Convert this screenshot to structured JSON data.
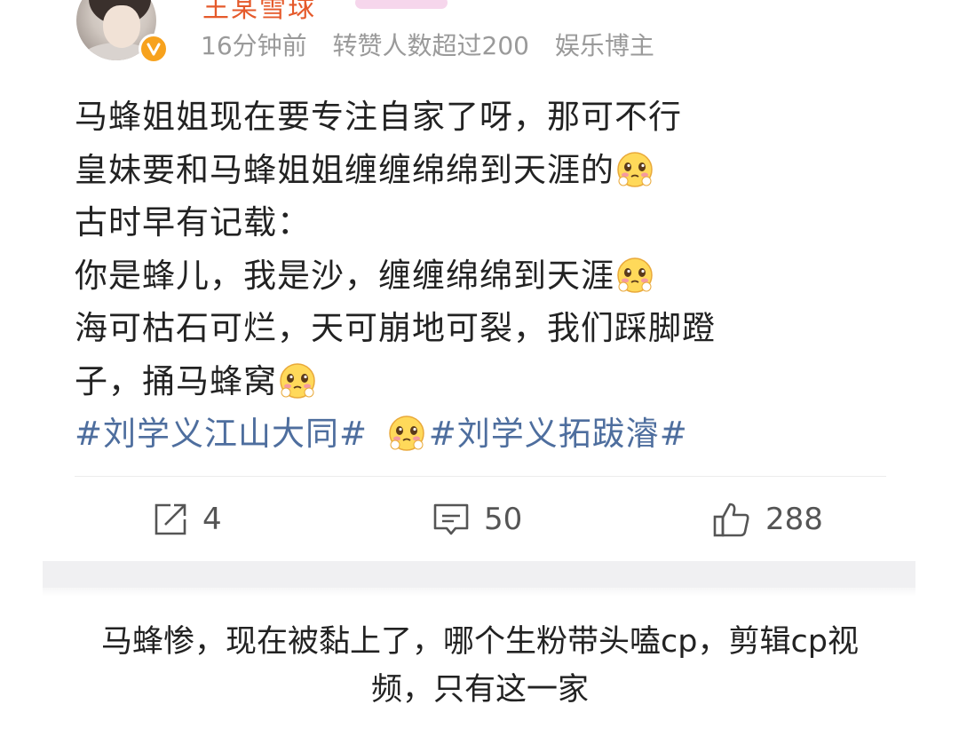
{
  "header": {
    "username": "王某雪球",
    "time": "16分钟前",
    "reposts_note": "转赞人数超过200",
    "category": "娱乐博主"
  },
  "post": {
    "lines": [
      "马蜂姐姐现在要专注自家了呀，那可不行",
      "皇妹要和马蜂姐姐缠缠绵绵到天涯的",
      "古时早有记载：",
      "你是蜂儿，我是沙，缠缠绵绵到天涯",
      "海可枯石可烂，天可崩地可裂，我们踩脚蹬",
      "子，捅马蜂窝"
    ],
    "tags": [
      "#刘学义江山大同#",
      "#刘学义拓跋濬#"
    ],
    "emoji_icon": "blushing-face-emoji"
  },
  "actions": {
    "repost_count": "4",
    "comment_count": "50",
    "like_count": "288"
  },
  "caption": {
    "line1": "马蜂惨，现在被黏上了，哪个生粉带头嗑cp，剪辑cp视",
    "line2": "频，只有这一家"
  },
  "colors": {
    "accent": "#f7a21d",
    "tag": "#4e6e9e",
    "text": "#222222",
    "meta": "#9a9a9a"
  }
}
